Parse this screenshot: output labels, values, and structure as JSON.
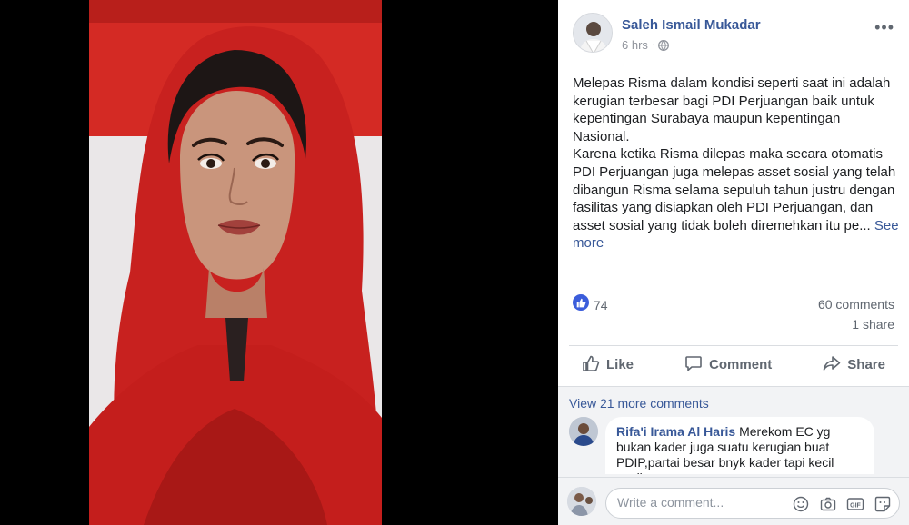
{
  "post": {
    "author": "Saleh Ismail Mukadar",
    "time": "6 hrs",
    "dot": "·",
    "text": "Melepas Risma dalam kondisi seperti saat ini adalah kerugian terbesar bagi PDI Perjuangan baik untuk kepentingan Surabaya maupun kepentingan Nasional.\nKarena ketika Risma dilepas maka secara otomatis PDI Perjuangan juga melepas asset sosial yang telah dibangun Risma selama sepuluh tahun justru dengan fasilitas yang disiapkan oleh PDI Perjuangan, dan asset sosial yang tidak boleh diremehkan itu pe... ",
    "see_more": "See more",
    "more_options": "•••"
  },
  "stats": {
    "likes": "74",
    "comments": "60 comments",
    "shares": "1 share"
  },
  "actions": {
    "like": "Like",
    "comment": "Comment",
    "share": "Share"
  },
  "comments": {
    "view_more": "View 21 more comments",
    "items": [
      {
        "author": "Rifa'i Irama Al Haris",
        "text": "Merekom EC yg bukan kader juga suatu kerugian buat PDIP,partai besar bnyk kader tapi kecil nyali"
      }
    ]
  },
  "composer": {
    "placeholder": "Write a comment..."
  },
  "colors": {
    "link": "#385898",
    "like_blue": "#3b5ddb",
    "scarf_red": "#c8211f",
    "flag_red": "#d42a24"
  },
  "icons": [
    "globe-icon",
    "like-icon",
    "comment-icon",
    "share-icon",
    "emoji-icon",
    "camera-icon",
    "gif-icon",
    "sticker-icon",
    "more-icon"
  ]
}
